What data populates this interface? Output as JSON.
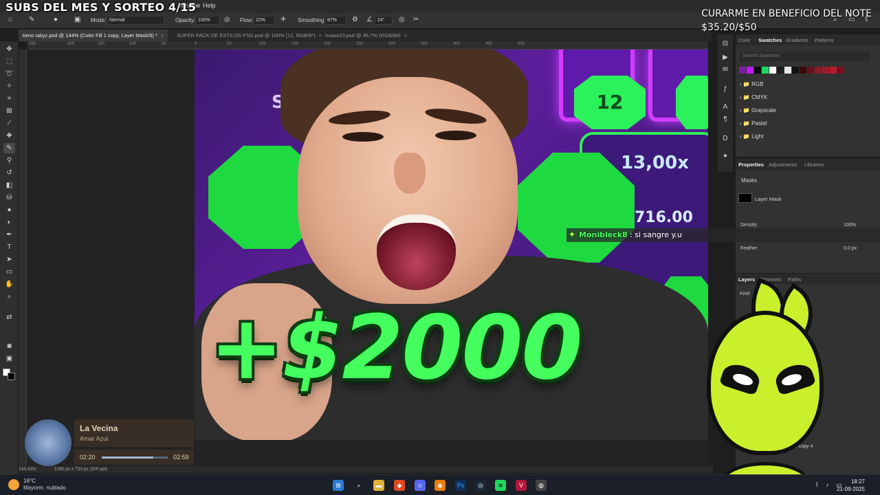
{
  "stream_overlay": {
    "title": "SUBS DEL MES Y SORTEO 4/15",
    "goal_label": "CURARME EN BENEFICIO DEL NOTE",
    "goal_amount": "$35.20/$50"
  },
  "menubar": {
    "window": "Window",
    "help": "Help"
  },
  "options_bar": {
    "mode_label": "Mode:",
    "mode_value": "Normal",
    "opacity_label": "Opacity:",
    "opacity_value": "100%",
    "flow_label": "Flow:",
    "flow_value": "22%",
    "smoothing_label": "Smoothing:",
    "smoothing_value": "87%",
    "angle_value": "24°"
  },
  "tabs": [
    {
      "label": "keno rakyz.psd @ 144% (Color Fill 1 copy, Layer Mask/8) *",
      "active": true
    },
    {
      "label": "SUPER PACK DE ESTILOS PSD.psd @ 100% (12, RGB/8*)",
      "active": false
    },
    {
      "label": "huaso23.psd @ 46,7% (RGB/8#)",
      "active": false
    }
  ],
  "ruler_ticks": [
    "250",
    "200",
    "150",
    "100",
    "50",
    "0",
    "50",
    "100",
    "150",
    "200",
    "250",
    "300",
    "350",
    "400",
    "450",
    "500"
  ],
  "canvas": {
    "tile_number": "12",
    "s_letter": "S",
    "multiplier": "13,00x",
    "balance": "716.00",
    "amount": "+$2000"
  },
  "chat": {
    "user": "Monibleck8",
    "message": ": si sangre y.u"
  },
  "swatches_panel": {
    "tabs": [
      "Color",
      "Swatches",
      "Gradients",
      "Patterns"
    ],
    "search_placeholder": "Search Swatches",
    "colors": [
      "#7a1fa0",
      "#c11aff",
      "#0a0a0a",
      "#1ed760",
      "#ffffff",
      "#1e1e1e",
      "#e8e8e8",
      "#111111",
      "#3a0a0a",
      "#6a1020",
      "#8a1a28",
      "#a11b2c",
      "#b71c2d",
      "#7a0e1e"
    ],
    "groups": [
      "RGB",
      "CMYK",
      "Grayscale",
      "Pastel",
      "Light"
    ]
  },
  "properties_panel": {
    "tabs": [
      "Properties",
      "Adjustments",
      "Libraries"
    ],
    "masks_label": "Masks",
    "layer_mask_label": "Layer Mask",
    "density_label": "Density:",
    "density_value": "100%",
    "feather_label": "Feather:",
    "feather_value": "0,0 px"
  },
  "layers_panel": {
    "tabs": [
      "Layers",
      "Channels",
      "Paths"
    ],
    "kind_label": "Kind",
    "layer_suffix": "e copy 4"
  },
  "music": {
    "title": "La Vecina",
    "artist": "Amar Azul",
    "elapsed": "02:20",
    "total": "02:59",
    "progress": 0.78
  },
  "status": {
    "zoom": "144,43%",
    "doc": "1280 px x 720 px (300 ppi)"
  },
  "taskbar": {
    "temp": "16°C",
    "weather": "Mayorm. nublado",
    "time": "18:27",
    "date": "21-09-2025"
  }
}
